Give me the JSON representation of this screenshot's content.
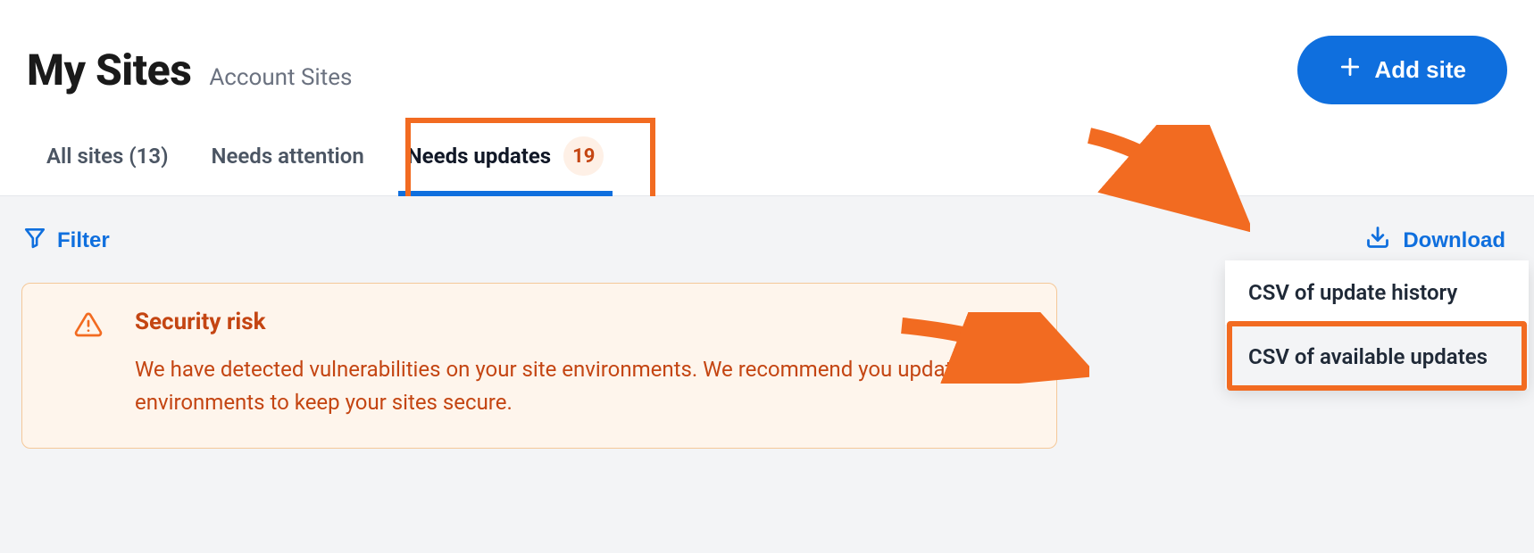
{
  "header": {
    "title": "My Sites",
    "subtitle": "Account Sites",
    "add_site_label": "Add site"
  },
  "tabs": {
    "all_sites": {
      "label": "All sites (13)"
    },
    "needs_attention": {
      "label": "Needs attention"
    },
    "needs_updates": {
      "label": "Needs updates",
      "badge": "19"
    }
  },
  "toolbar": {
    "filter_label": "Filter",
    "download_label": "Download"
  },
  "alert": {
    "title": "Security risk",
    "text": "We have detected vulnerabilities on your site environments. We recommend you update those environments to keep your sites secure."
  },
  "download_menu": {
    "item1": "CSV of update history",
    "item2": "CSV of available updates"
  },
  "colors": {
    "primary": "#0f6fde",
    "accent_orange": "#f26b21",
    "warn_text": "#c44512",
    "warn_bg": "#fef5ec"
  }
}
